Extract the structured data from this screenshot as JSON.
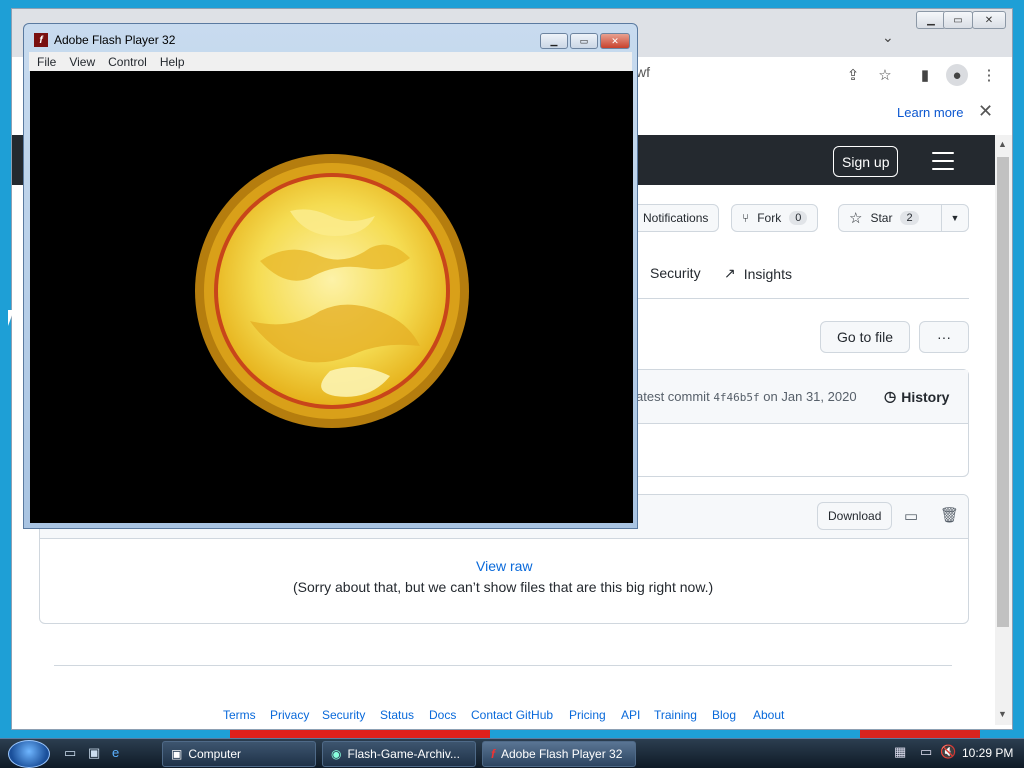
{
  "flash": {
    "title": "Adobe Flash Player 32",
    "menu": [
      "File",
      "View",
      "Control",
      "Help"
    ],
    "window_buttons": {
      "min": "▁",
      "max": "▭",
      "close": "✕"
    }
  },
  "chrome": {
    "url_fragment": "wf",
    "infobar_link": "Learn more",
    "window_buttons": {
      "min": "▁",
      "max": "▭",
      "close": "✕"
    }
  },
  "github": {
    "signup": "Sign up",
    "notifications": "Notifications",
    "fork_label": "Fork",
    "fork_count": "0",
    "star_label": "Star",
    "star_count": "2",
    "nav": {
      "security": "Security",
      "insights": "Insights"
    },
    "go_to_file": "Go to file",
    "more": "···",
    "commit_text": "atest commit",
    "commit_hash": "4f46b5f",
    "commit_date": "on Jan 31, 2020",
    "history": "History",
    "download": "Download",
    "view_raw": "View raw",
    "too_big": "(Sorry about that, but we can’t show files that are this big right now.)",
    "footer": [
      "Terms",
      "Privacy",
      "Security",
      "Status",
      "Docs",
      "Contact GitHub",
      "Pricing",
      "API",
      "Training",
      "Blog",
      "About"
    ]
  },
  "taskbar": {
    "tasks": [
      "Computer",
      "Flash-Game-Archiv...",
      "Adobe Flash Player 32"
    ],
    "clock": "10:29 PM"
  },
  "colors": {
    "accent": "#0969da",
    "header": "#24292f",
    "sun_core": "#f7e36a",
    "sun_rim": "#c58a12"
  }
}
